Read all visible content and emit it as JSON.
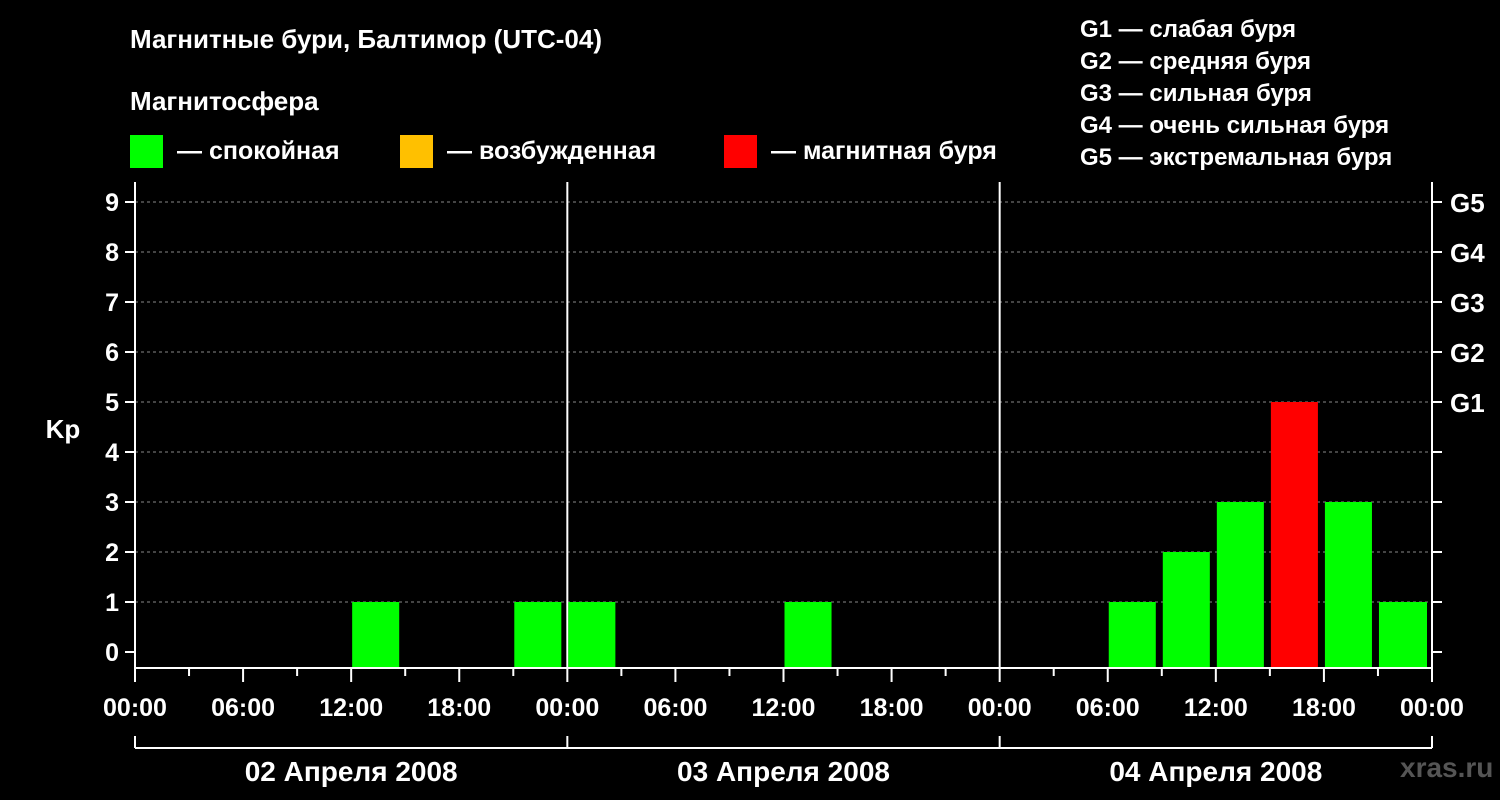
{
  "title": "Магнитные бури, Балтимор (UTC-04)",
  "subtitle": "Магнитосфера",
  "legend": [
    {
      "color": "#00ff00",
      "label": "— спокойная"
    },
    {
      "color": "#ffc000",
      "label": "— возбужденная"
    },
    {
      "color": "#ff0000",
      "label": "— магнитная буря"
    }
  ],
  "g_legend": [
    "G1 — слабая буря",
    "G2 — средняя буря",
    "G3 — сильная буря",
    "G4 — очень сильная буря",
    "G5 — экстремальная буря"
  ],
  "watermark": "xras.ru",
  "chart_data": {
    "type": "bar",
    "ylabel": "Kp",
    "ylim": [
      0,
      9
    ],
    "y_ticks": [
      0,
      1,
      2,
      3,
      4,
      5,
      6,
      7,
      8,
      9
    ],
    "right_ticks": [
      {
        "value": 5,
        "label": "G1"
      },
      {
        "value": 6,
        "label": "G2"
      },
      {
        "value": 7,
        "label": "G3"
      },
      {
        "value": 8,
        "label": "G4"
      },
      {
        "value": 9,
        "label": "G5"
      }
    ],
    "x_unit": "hours",
    "xlim": [
      0,
      72
    ],
    "x_tick_labels": [
      "00:00",
      "06:00",
      "12:00",
      "18:00",
      "00:00",
      "06:00",
      "12:00",
      "18:00",
      "00:00",
      "06:00",
      "12:00",
      "18:00",
      "00:00"
    ],
    "days": [
      "02 Апреля 2008",
      "03 Апреля 2008",
      "04 Апреля 2008"
    ],
    "grid": true,
    "colors": {
      "quiet": "#00ff00",
      "active": "#ffc000",
      "storm": "#ff0000"
    },
    "bars": [
      {
        "start": 0,
        "end": 3,
        "kp": 0
      },
      {
        "start": 3,
        "end": 6,
        "kp": 0
      },
      {
        "start": 6,
        "end": 9,
        "kp": 0
      },
      {
        "start": 9,
        "end": 12,
        "kp": 0
      },
      {
        "start": 12,
        "end": 15,
        "kp": 1
      },
      {
        "start": 15,
        "end": 18,
        "kp": 0
      },
      {
        "start": 18,
        "end": 21,
        "kp": 0
      },
      {
        "start": 21,
        "end": 24,
        "kp": 1
      },
      {
        "start": 24,
        "end": 27,
        "kp": 1
      },
      {
        "start": 27,
        "end": 30,
        "kp": 0
      },
      {
        "start": 30,
        "end": 33,
        "kp": 0
      },
      {
        "start": 33,
        "end": 36,
        "kp": 0
      },
      {
        "start": 36,
        "end": 39,
        "kp": 1
      },
      {
        "start": 39,
        "end": 42,
        "kp": 0
      },
      {
        "start": 42,
        "end": 45,
        "kp": 0
      },
      {
        "start": 45,
        "end": 48,
        "kp": 0
      },
      {
        "start": 48,
        "end": 51,
        "kp": 0
      },
      {
        "start": 51,
        "end": 54,
        "kp": 0
      },
      {
        "start": 54,
        "end": 57,
        "kp": 1
      },
      {
        "start": 57,
        "end": 60,
        "kp": 2
      },
      {
        "start": 60,
        "end": 63,
        "kp": 3
      },
      {
        "start": 63,
        "end": 66,
        "kp": 5
      },
      {
        "start": 66,
        "end": 69,
        "kp": 3
      },
      {
        "start": 69,
        "end": 72,
        "kp": 1
      },
      {
        "start": 72,
        "end": 72,
        "kp": 1
      }
    ]
  }
}
